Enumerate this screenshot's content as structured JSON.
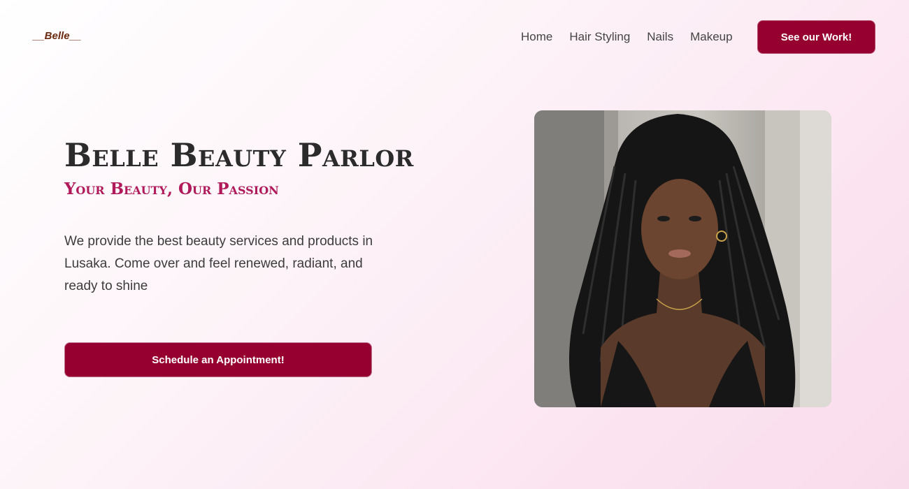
{
  "header": {
    "logo": "__Belle__",
    "nav": [
      "Home",
      "Hair Styling",
      "Nails",
      "Makeup"
    ],
    "cta_label": "See our Work!"
  },
  "hero": {
    "title": "Belle Beauty Parlor",
    "subtitle": "Your Beauty, Our Passion",
    "description": "We provide the best beauty services and products in Lusaka. Come over and feel renewed, radiant, and ready to shine",
    "cta_label": "Schedule an Appointment!",
    "photo_alt": "woman-with-braided-hair-photo"
  },
  "colors": {
    "accent": "#960030",
    "subtitle": "#b01a5a",
    "logo": "#6b2a10"
  }
}
